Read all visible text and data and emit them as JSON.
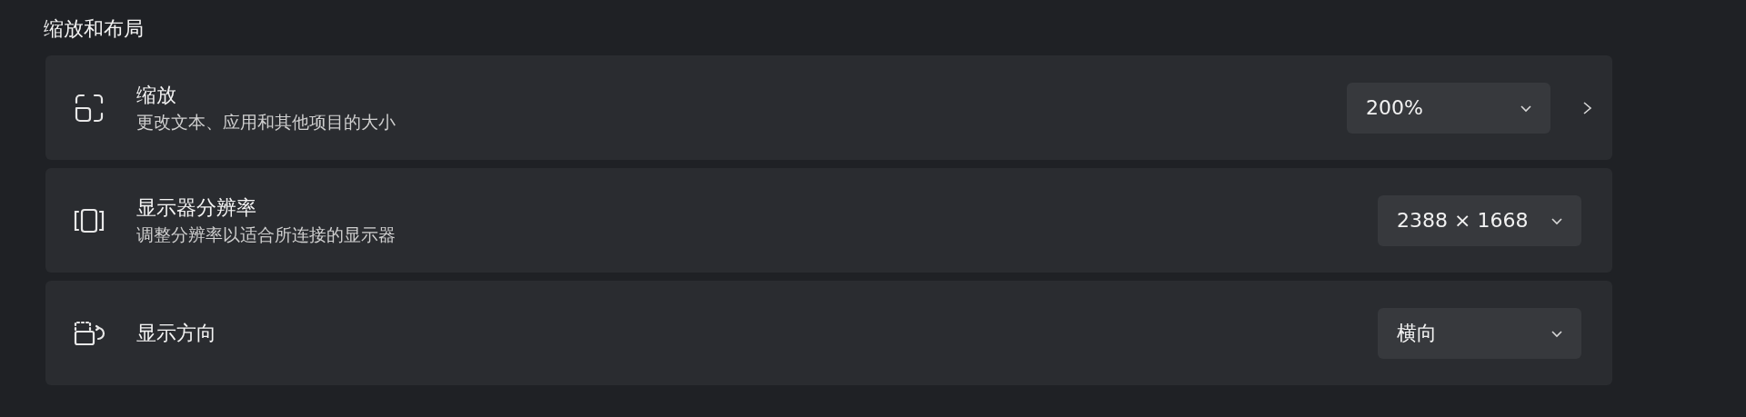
{
  "section": {
    "title": "缩放和布局"
  },
  "settings": [
    {
      "kind": "scale",
      "label": "缩放",
      "description": "更改文本、应用和其他项目的大小",
      "dropdown": "200%",
      "has_arrow": true
    },
    {
      "kind": "resolution",
      "label": "显示器分辨率",
      "description": "调整分辨率以适合所连接的显示器",
      "dropdown": "2388 × 1668",
      "has_arrow": false
    },
    {
      "kind": "orientation",
      "label": "显示方向",
      "dropdown": "横向",
      "has_arrow": false
    }
  ]
}
